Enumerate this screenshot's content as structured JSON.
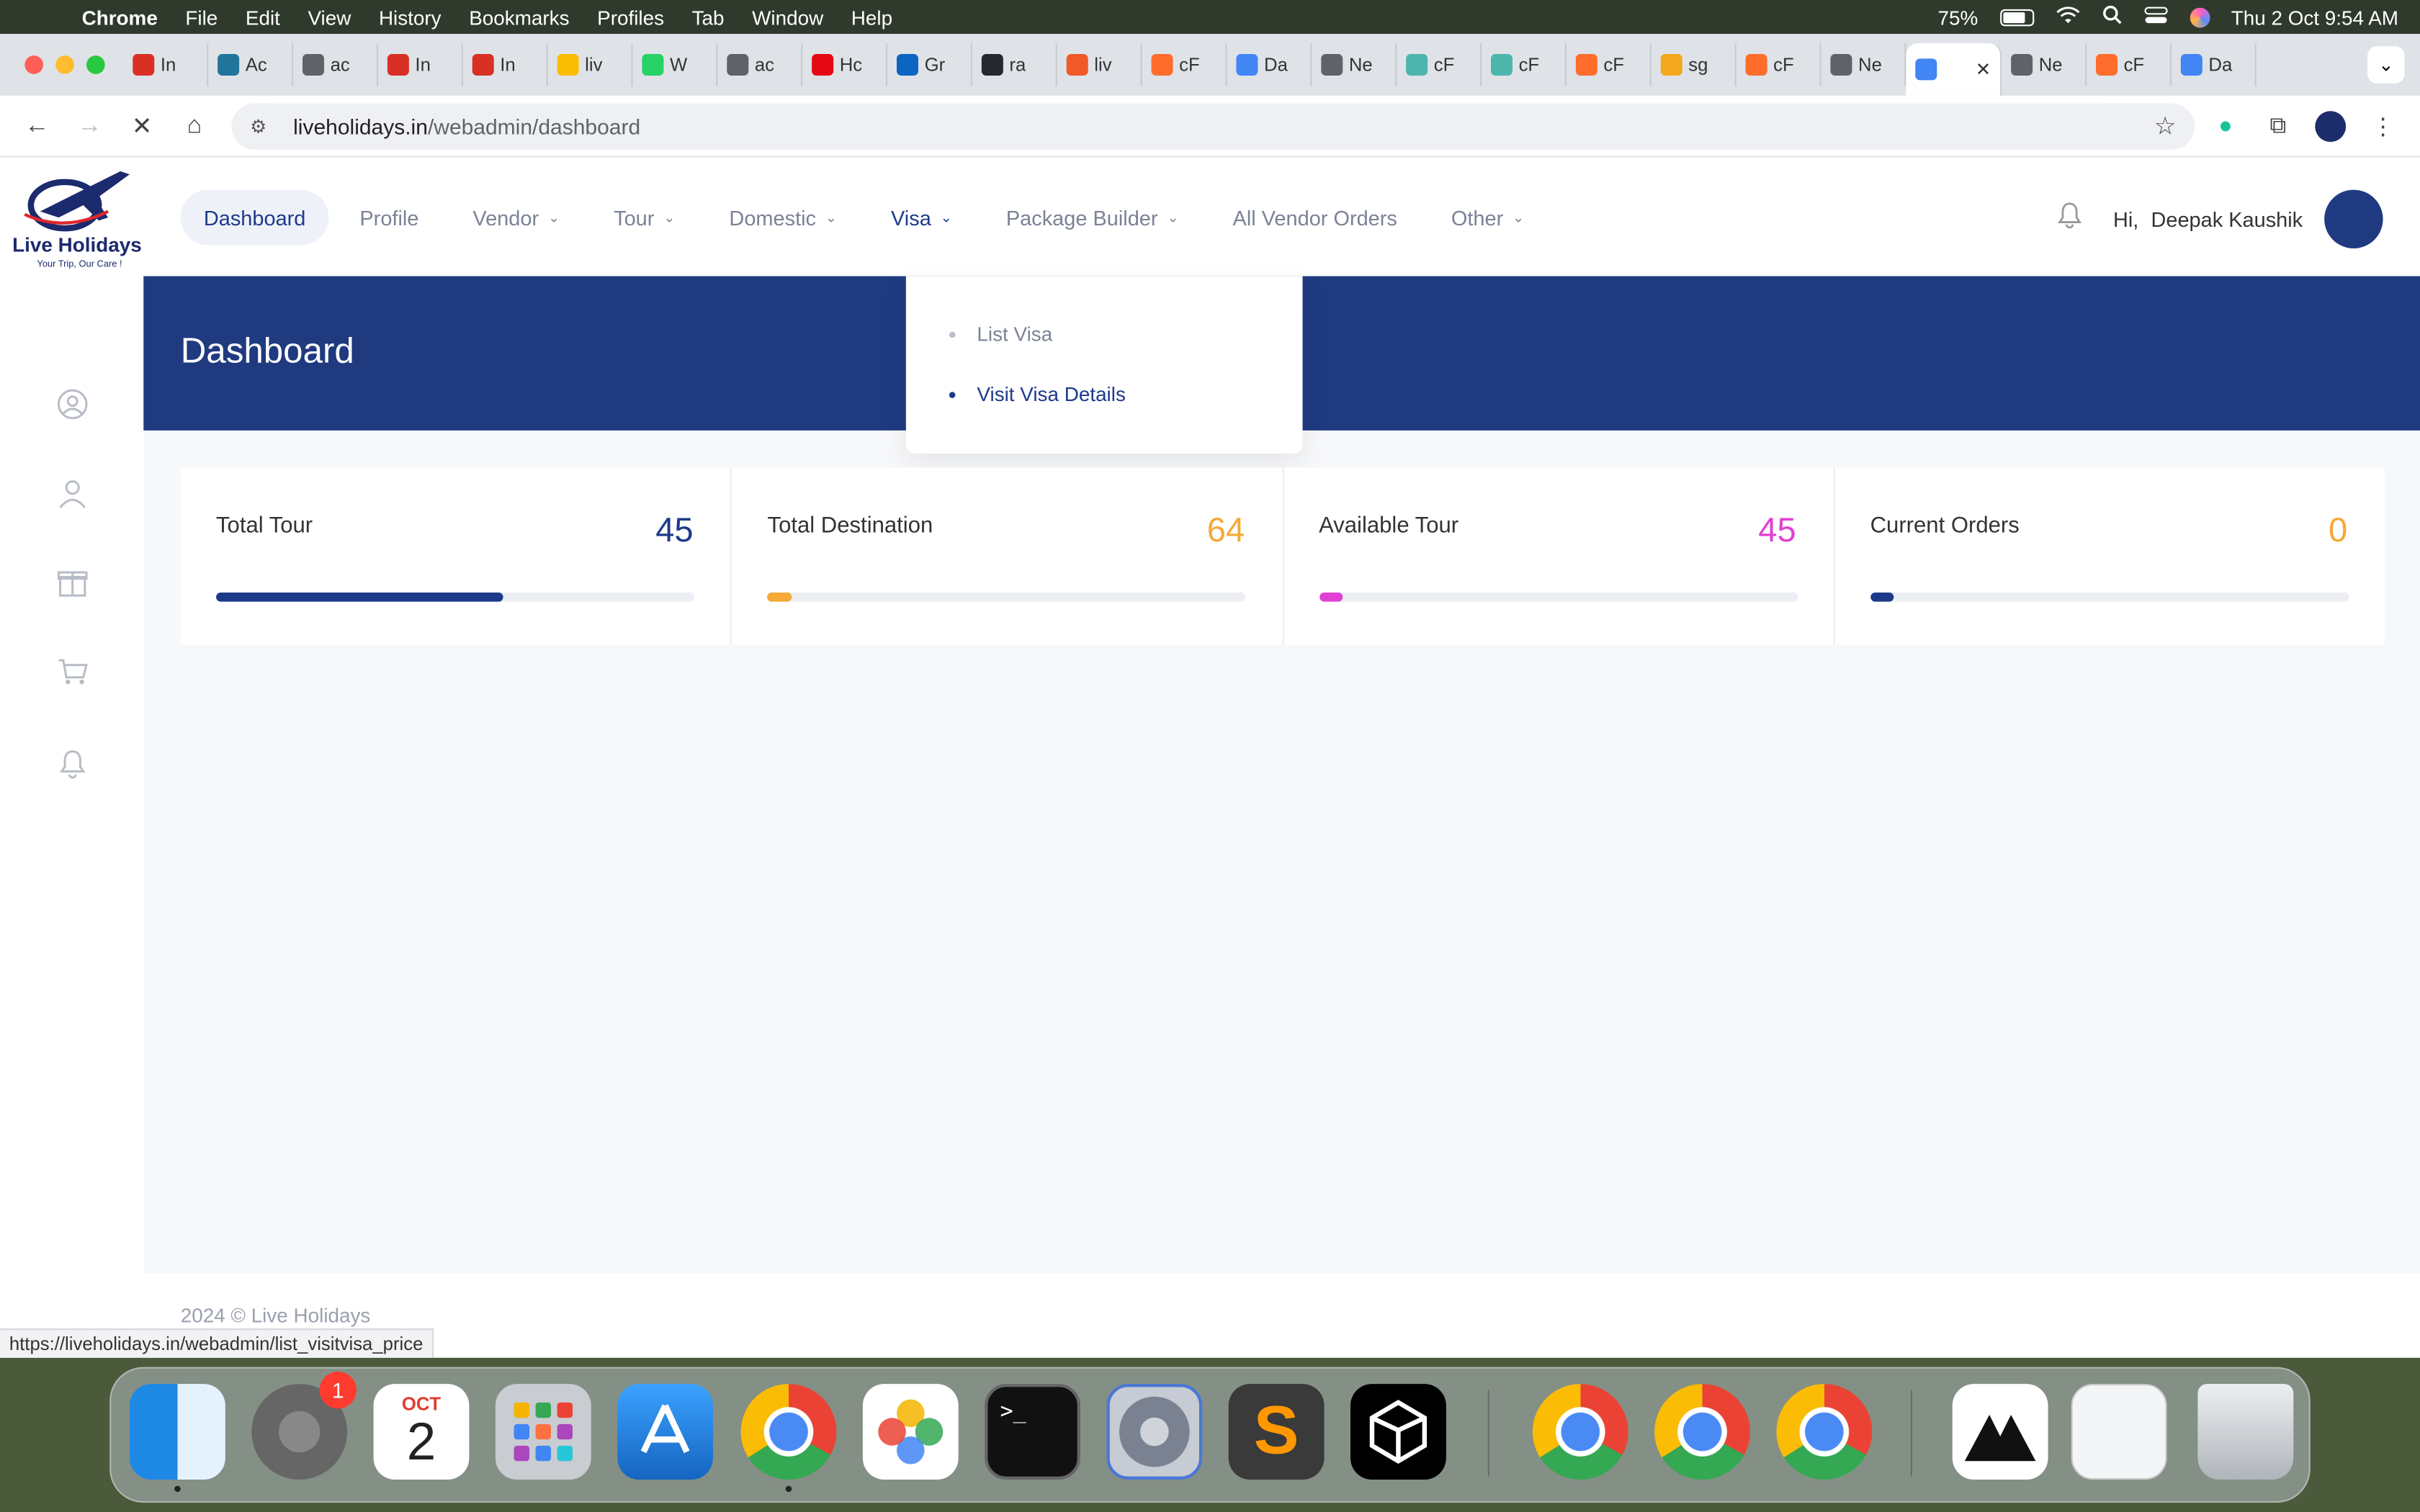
{
  "menubar": {
    "app": "Chrome",
    "items": [
      "File",
      "Edit",
      "View",
      "History",
      "Bookmarks",
      "Profiles",
      "Tab",
      "Window",
      "Help"
    ],
    "battery": "75%",
    "datetime": "Thu 2 Oct  9:54 AM"
  },
  "browser": {
    "tabs": [
      {
        "label": "In",
        "color": "#d93025"
      },
      {
        "label": "Ac",
        "color": "#21759b"
      },
      {
        "label": "ac",
        "color": "#5f6368"
      },
      {
        "label": "In",
        "color": "#d93025"
      },
      {
        "label": "In",
        "color": "#d93025"
      },
      {
        "label": "liv",
        "color": "#fbbc04"
      },
      {
        "label": "W",
        "color": "#25d366"
      },
      {
        "label": "ac",
        "color": "#5f6368"
      },
      {
        "label": "Hc",
        "color": "#e50914"
      },
      {
        "label": "Gr",
        "color": "#0a66c2"
      },
      {
        "label": "ra",
        "color": "#24292f"
      },
      {
        "label": "liv",
        "color": "#f1592a"
      },
      {
        "label": "cF",
        "color": "#ff6c2c"
      },
      {
        "label": "Da",
        "color": "#4285f4"
      },
      {
        "label": "Ne",
        "color": "#5f6368"
      },
      {
        "label": "cF",
        "color": "#4db6ac"
      },
      {
        "label": "cF",
        "color": "#4db6ac"
      },
      {
        "label": "cF",
        "color": "#ff6c2c"
      },
      {
        "label": "sg",
        "color": "#f4a61c"
      },
      {
        "label": "cF",
        "color": "#ff6c2c"
      },
      {
        "label": "Ne",
        "color": "#5f6368"
      },
      {
        "label": "",
        "color": "#4285f4",
        "active": true
      },
      {
        "label": "Ne",
        "color": "#5f6368"
      },
      {
        "label": "cF",
        "color": "#ff6c2c"
      },
      {
        "label": "Da",
        "color": "#4285f4"
      }
    ],
    "url_host": "liveholidays.in",
    "url_path": "/webadmin/dashboard",
    "status_url": "https://liveholidays.in/webadmin/list_visitvisa_price"
  },
  "site": {
    "logo_text": "Live Holidays",
    "tagline": "Your Trip, Our Care !",
    "nav": [
      {
        "label": "Dashboard",
        "active": true
      },
      {
        "label": "Profile"
      },
      {
        "label": "Vendor",
        "dropdown": true
      },
      {
        "label": "Tour",
        "dropdown": true
      },
      {
        "label": "Domestic",
        "dropdown": true
      },
      {
        "label": "Visa",
        "dropdown": true,
        "open": true
      },
      {
        "label": "Package Builder",
        "dropdown": true
      },
      {
        "label": "All Vendor Orders"
      },
      {
        "label": "Other",
        "dropdown": true
      }
    ],
    "greeting": "Hi,",
    "user_name": "Deepak Kaushik",
    "visa_menu": [
      "List Visa",
      "Visit Visa Details"
    ],
    "page_title": "Dashboard",
    "stats": [
      {
        "label": "Total Tour",
        "value": "45",
        "color": "#1d3a8a",
        "progress": 0.6
      },
      {
        "label": "Total Destination",
        "value": "64",
        "color": "#f5a936",
        "progress": 0.05
      },
      {
        "label": "Available Tour",
        "value": "45",
        "color": "#e23fd3",
        "progress": 0.05
      },
      {
        "label": "Current Orders",
        "value": "0",
        "color": "#f5a936",
        "bar_color": "#1d3a8a",
        "progress": 0.05
      }
    ],
    "footer": "2024 © Live Holidays"
  },
  "dock": {
    "calendar_month": "OCT",
    "calendar_day": "2",
    "settings_badge": "1",
    "terminal_prompt": ">_"
  }
}
